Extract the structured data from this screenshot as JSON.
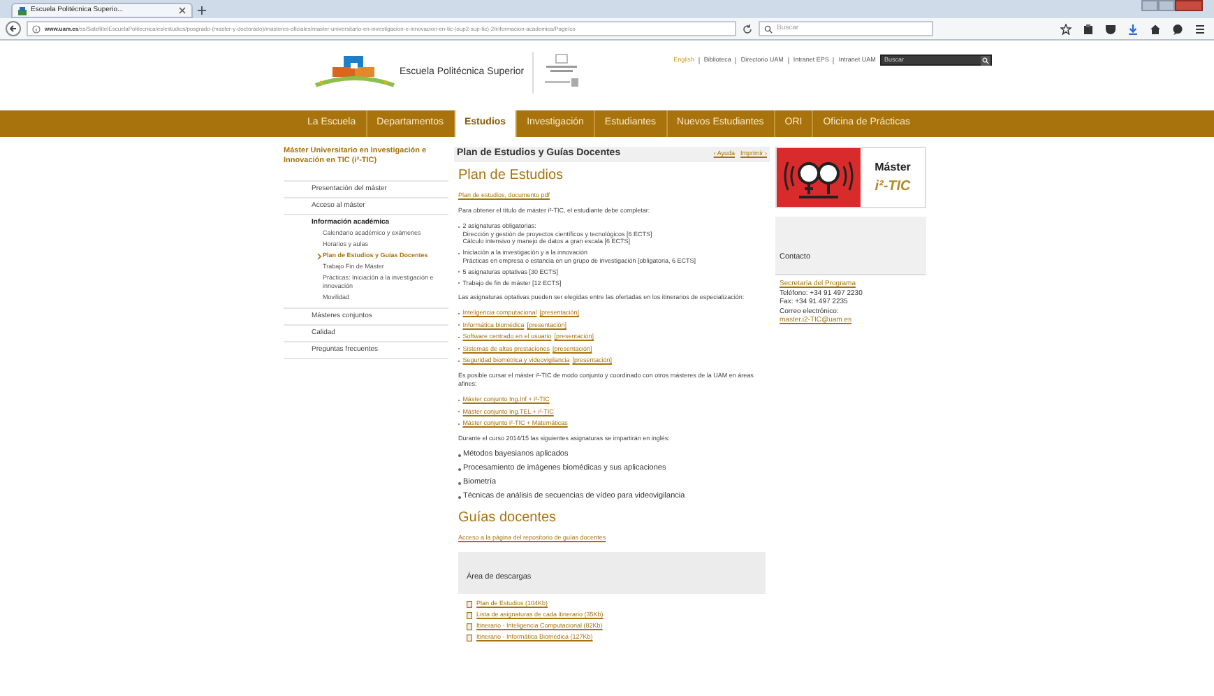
{
  "browser": {
    "tab_title": "Escuela Politécnica Superio...",
    "url_domain": "www.uam.es",
    "url_path": "/ss/Satellite/EscuelaPolitecnica/es/estudios/posgrado-(master-y-doctorado)/masteres-oficiales/master-universitario-en-investigacion-e-innovacion-en-tic-(oup2-sup-tic)-2/informacion-academica/Page/co",
    "search_placeholder": "Buscar"
  },
  "header": {
    "school_name": "Escuela Politécnica Superior",
    "top_links": [
      {
        "text": "English",
        "highlight": true
      },
      {
        "text": "Biblioteca",
        "highlight": false
      },
      {
        "text": "Directorio UAM",
        "highlight": false
      },
      {
        "text": "Intranet EPS",
        "highlight": false
      },
      {
        "text": "Intranet UAM",
        "highlight": false
      }
    ],
    "search_placeholder": "Buscar"
  },
  "nav": [
    {
      "label": "La Escuela",
      "selected": false
    },
    {
      "label": "Departamentos",
      "selected": false
    },
    {
      "label": "Estudios",
      "selected": true
    },
    {
      "label": "Investigación",
      "selected": false
    },
    {
      "label": "Estudiantes",
      "selected": false
    },
    {
      "label": "Nuevos Estudiantes",
      "selected": false
    },
    {
      "label": "ORI",
      "selected": false
    },
    {
      "label": "Oficina de Prácticas",
      "selected": false
    }
  ],
  "sidebar": {
    "title": "Máster Universitario en Investigación e Innovación en TIC (i²-TIC)",
    "items": [
      {
        "label": "Presentación del máster",
        "selected": false,
        "expanded": false
      },
      {
        "label": "Acceso al máster",
        "selected": false,
        "expanded": false
      },
      {
        "label": "Información académica",
        "selected": false,
        "expanded": true,
        "children": [
          {
            "label": "Calendario académico y exámenes",
            "selected": false
          },
          {
            "label": "Horarios y aulas",
            "selected": false
          },
          {
            "label": "Plan de Estudios y Guías Docentes",
            "selected": true
          },
          {
            "label": "Trabajo Fin de Máster",
            "selected": false
          },
          {
            "label": "Prácticas: Iniciación a la investigación e innovación",
            "selected": false
          },
          {
            "label": "Movilidad",
            "selected": false
          }
        ]
      },
      {
        "label": "Másteres conjuntos",
        "selected": false,
        "expanded": false
      },
      {
        "label": "Calidad",
        "selected": false,
        "expanded": false
      },
      {
        "label": "Preguntas frecuentes",
        "selected": false,
        "expanded": false
      }
    ]
  },
  "main": {
    "page_title": "Plan de Estudios y Guías Docentes",
    "help_link": "‹ Ayuda",
    "print_link": "Imprimir ›",
    "content": [
      {
        "kind": "heading",
        "text": "Plan de Estudios"
      },
      {
        "kind": "link",
        "text": "Plan de estudios, documento pdf"
      },
      {
        "kind": "paragraph",
        "text": "Para obtener el título de máster i²-TIC, el estudiante debe completar:"
      },
      {
        "kind": "bullets",
        "items": [
          {
            "lines": [
              "2 asignaturas obligatorias:",
              "Dirección y gestión de proyectos científicos y tecnológicos [6 ECTS]",
              "Cálculo intensivo y manejo de datos a gran escala [6 ECTS]"
            ]
          },
          {
            "lines": [
              "Iniciación a la investigación y a la innovación",
              "Prácticas en empresa o estancia en un grupo de investigación [obligatoria, 6 ECTS]"
            ]
          },
          {
            "lines": [
              "5 asignaturas optativas [30 ECTS]"
            ]
          },
          {
            "lines": [
              "Trabajo de fin de máster [12 ECTS]"
            ]
          }
        ]
      },
      {
        "kind": "paragraph",
        "text": "Las asignaturas optativas pueden ser elegidas entre las ofertadas en los itinerarios de especialización:"
      },
      {
        "kind": "link_bullets",
        "items": [
          {
            "links": [
              "Inteligencia computacional",
              "[presentación]"
            ]
          },
          {
            "links": [
              "Informática biomédica",
              "[presentación]"
            ]
          },
          {
            "links": [
              "Software centrado en el usuario",
              "[presentación]"
            ]
          },
          {
            "links": [
              "Sistemas de altas prestaciones",
              "[presentación]"
            ]
          },
          {
            "links": [
              "Seguridad biométrica y videovigilancia",
              "[presentación]"
            ]
          }
        ]
      },
      {
        "kind": "paragraph",
        "text": "Es posible cursar el máster i²-TIC de modo conjunto y coordinado con otros másteres de la UAM en áreas afines:"
      },
      {
        "kind": "link_bullets",
        "items": [
          {
            "links": [
              "Máster conjunto Ing.Inf + i²-TIC"
            ]
          },
          {
            "links": [
              "Máster conjunto Ing.TEL + i²-TIC"
            ]
          },
          {
            "links": [
              "Máster conjunto i²-TIC + Matemáticas"
            ]
          }
        ]
      },
      {
        "kind": "paragraph",
        "text": "Durante el curso 2014/15 las siguientes asignaturas se impartirán en inglés:"
      },
      {
        "kind": "large_bullets",
        "items": [
          {
            "lines": [
              "Métodos bayesianos aplicados"
            ]
          },
          {
            "lines": [
              "Procesamiento de imágenes biomédicas y sus aplicaciones"
            ]
          },
          {
            "lines": [
              "Biometría"
            ]
          },
          {
            "lines": [
              "Técnicas de análisis de secuencias de vídeo para videovigilancia"
            ]
          }
        ]
      },
      {
        "kind": "heading",
        "text": "Guías docentes"
      },
      {
        "kind": "link",
        "text": "Acceso a la página del repositorio de guías docentes"
      }
    ],
    "downloads": {
      "title": "Área de descargas",
      "files": [
        "Plan de Estudios (104Kb)",
        "Lista de asignaturas de cada itinerario (35Kb)",
        "Itinerario - Inteligencia Computacional (82Kb)",
        "Itinerario - Informática Biomédica (127Kb)"
      ]
    }
  },
  "aside": {
    "logo_word": "Máster",
    "logo_name": "i²-TIC",
    "contact_title": "Contacto",
    "contact": [
      {
        "kind": "link",
        "text": "Secretaría del Programa"
      },
      {
        "kind": "text",
        "text": "Teléfono: +34 91 497 2230"
      },
      {
        "kind": "text",
        "text": "Fax: +34 91 497 2235"
      },
      {
        "kind": "text",
        "text": "Correo electrónico:"
      },
      {
        "kind": "link",
        "text": "master.i2-TIC@uam.es"
      }
    ]
  }
}
